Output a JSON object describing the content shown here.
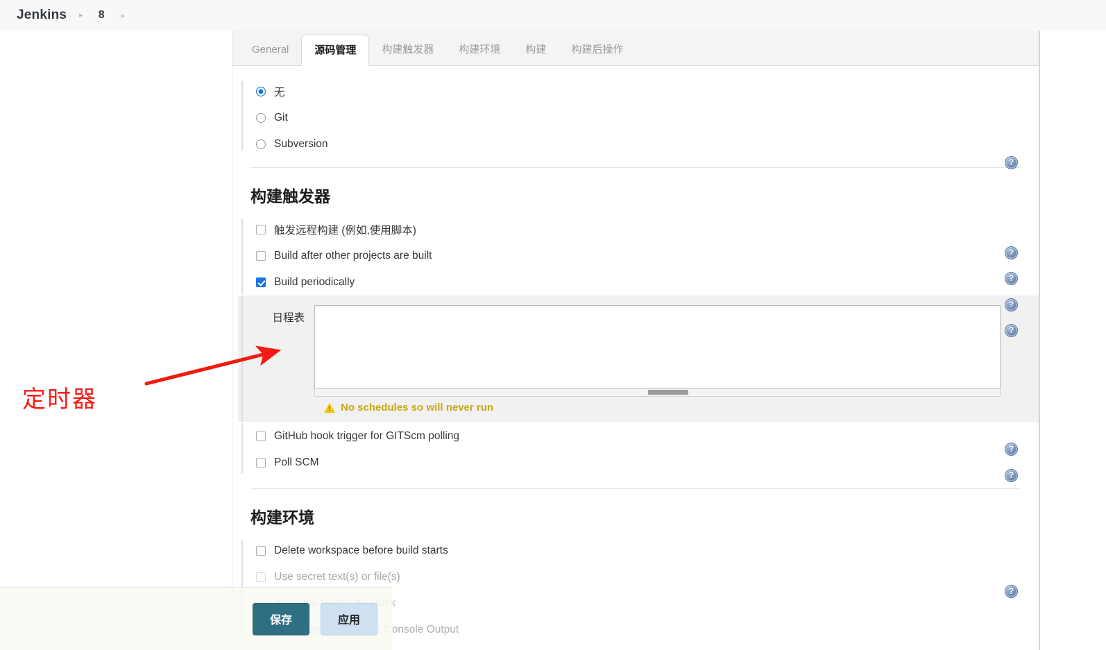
{
  "breadcrumb": {
    "brand": "Jenkins",
    "separator": "▸",
    "items": [
      {
        "label": "8"
      }
    ],
    "trailing_separator": "▸"
  },
  "tabs": [
    {
      "label": "General",
      "active": false
    },
    {
      "label": "源码管理",
      "active": true
    },
    {
      "label": "构建触发器",
      "active": false
    },
    {
      "label": "构建环境",
      "active": false
    },
    {
      "label": "构建",
      "active": false
    },
    {
      "label": "构建后操作",
      "active": false
    }
  ],
  "scm": {
    "options": [
      {
        "label": "无",
        "checked": true
      },
      {
        "label": "Git",
        "checked": false
      },
      {
        "label": "Subversion",
        "checked": false
      }
    ]
  },
  "build_triggers": {
    "heading": "构建触发器",
    "items": [
      {
        "label": "触发远程构建 (例如,使用脚本)",
        "checked": false
      },
      {
        "label": "Build after other projects are built",
        "checked": false
      },
      {
        "label": "Build periodically",
        "checked": true
      },
      {
        "label": "GitHub hook trigger for GITScm polling",
        "checked": false
      },
      {
        "label": "Poll SCM",
        "checked": false
      }
    ],
    "schedule": {
      "label": "日程表",
      "value": "",
      "warning": "No schedules so will never run",
      "warning_color": "#c9a913"
    }
  },
  "build_env": {
    "heading": "构建环境",
    "items": [
      {
        "label": "Delete workspace before build starts",
        "checked": false
      },
      {
        "label": "Use secret text(s) or file(s)",
        "checked": false
      },
      {
        "label": "Abort the build if it's stuck",
        "checked": false
      },
      {
        "label": "Add timestamps to the Console Output",
        "checked": false
      }
    ]
  },
  "help_icon": {
    "glyph": "?",
    "title": "help"
  },
  "action_bar": {
    "save_label": "保存",
    "apply_label": "应用",
    "save_color": "#2f6f82",
    "apply_color": "#cfe0f0"
  },
  "annotation": {
    "text": "定时器",
    "color": "#ff1a14",
    "arrow": "arrow pointing up-right toward schedule field"
  }
}
